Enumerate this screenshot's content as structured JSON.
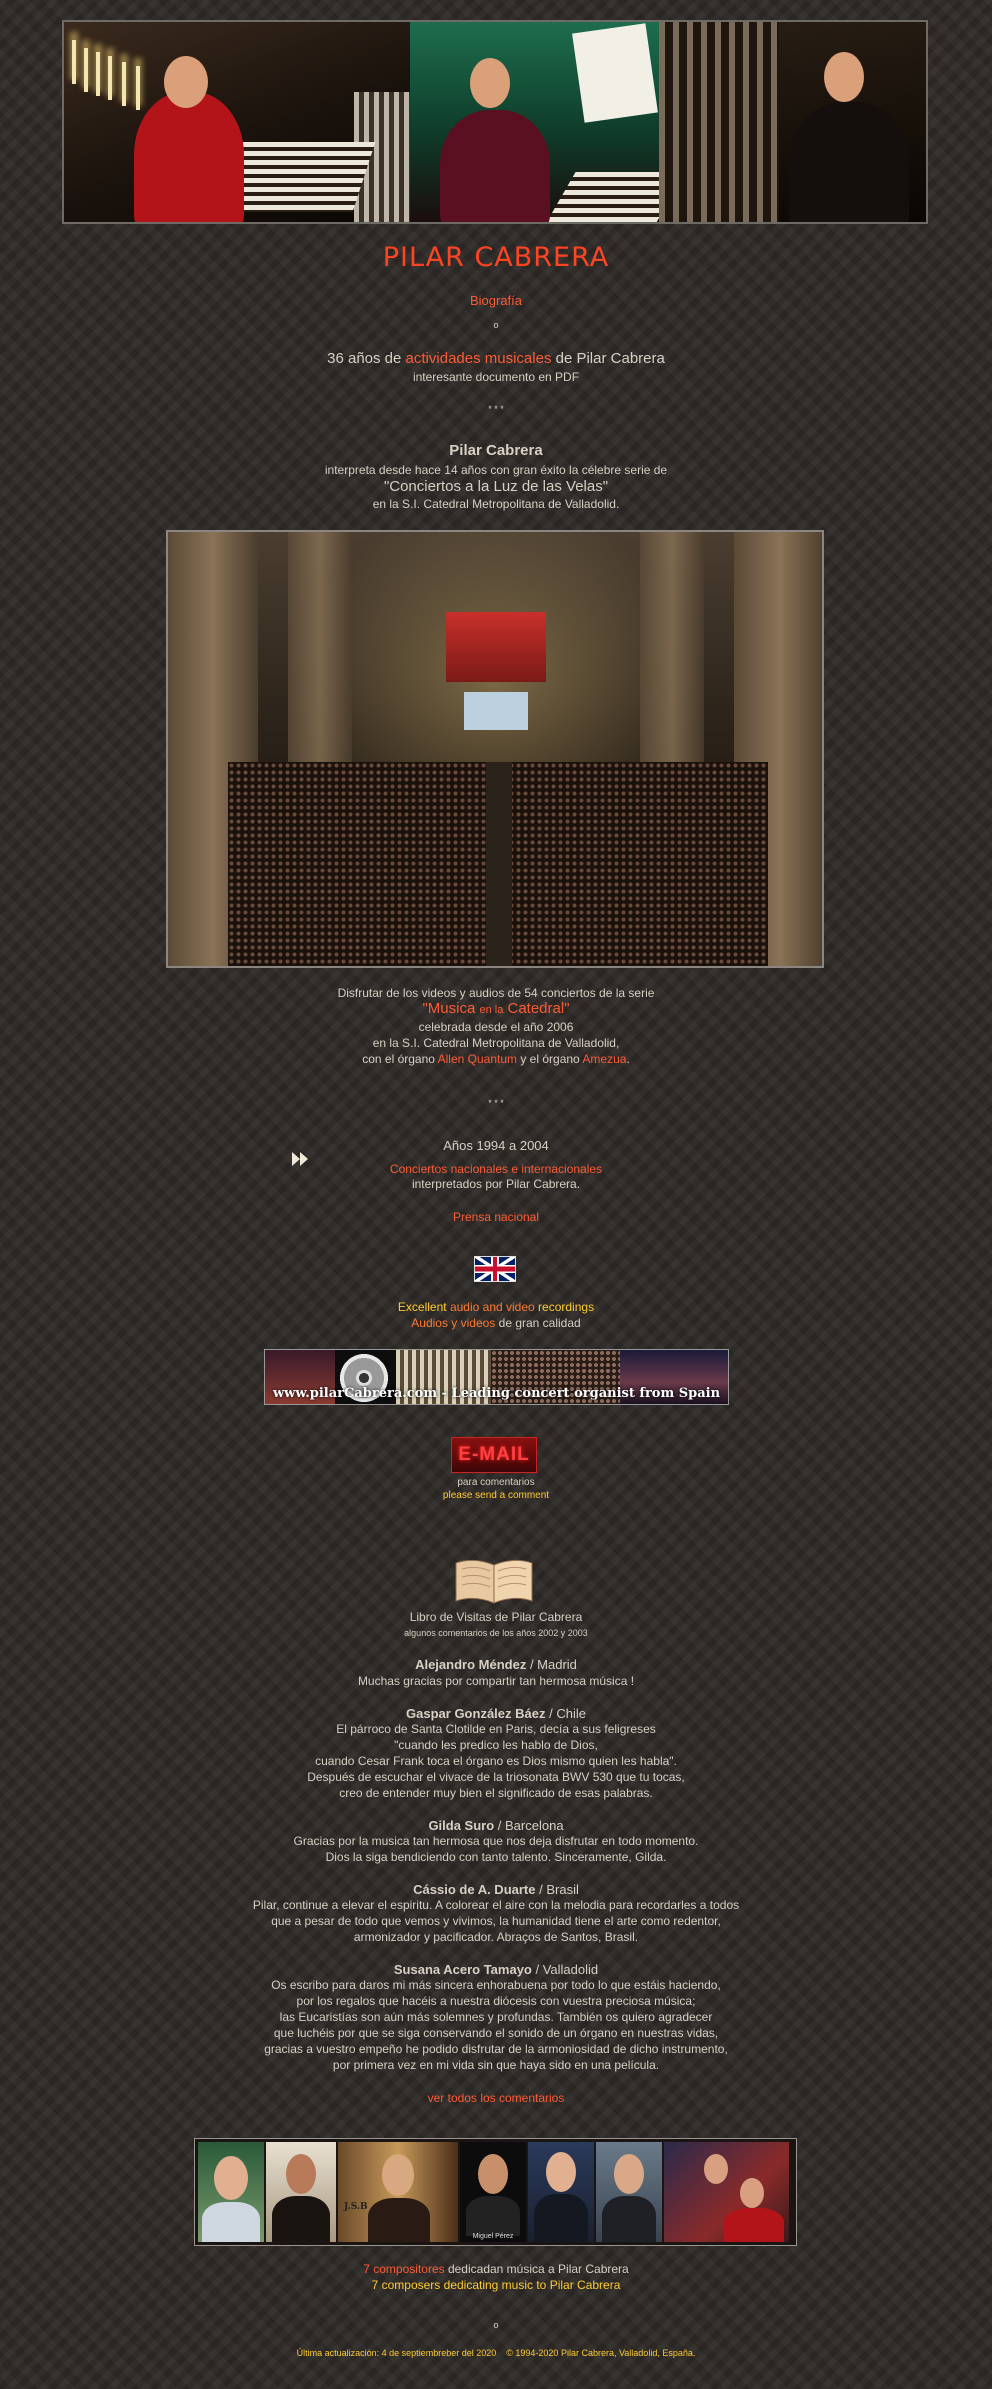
{
  "header": {
    "title": "PILAR CABRERA",
    "biography_link": "Biografía",
    "small_bullet": "o"
  },
  "activities": {
    "prefix": "36 años de ",
    "link": "actividades musicales",
    "suffix": " de Pilar Cabrera",
    "subtitle": "interesante documento en PDF"
  },
  "separator": "* * *",
  "concerts_intro": {
    "name": "Pilar Cabrera",
    "line1": "interpreta desde hace 14 años con gran éxito la célebre serie de",
    "series": "\"Conciertos a la Luz de las Velas\"",
    "line3": "en la S.I. Catedral Metropolitana de Valladolid."
  },
  "videos": {
    "line1": "Disfrutar de los videos y audios de 54 conciertos de la serie",
    "series_prefix": "\"Musica ",
    "series_small": "en la",
    "series_suffix": " Catedral\"",
    "line3": "celebrada desde el año 2006",
    "line4": "en la S.I. Catedral Metropolitana de Valladolid,",
    "organ_prefix": "con el órgano ",
    "organ1": "Allen Quantum",
    "organ_mid": " y el órgano ",
    "organ2": "Amezua",
    "organ_end": "."
  },
  "years": {
    "title": "Años 1994 a 2004",
    "link": "Conciertos nacionales e internacionales",
    "subtitle": "interpretados por Pilar Cabrera.",
    "press": "Prensa nacional"
  },
  "recordings": {
    "en_excellent": "Excellent ",
    "en_link": "audio and video",
    "en_recordings": " recordings",
    "es_link": "Audios y videos",
    "es_suffix": " de gran calidad",
    "banner_text": "www.pilarCabrera.com - Leading concert organist from Spain"
  },
  "email": {
    "button": "E-MAIL",
    "line1": "para comentarios",
    "line2": "please send a comment"
  },
  "guestbook": {
    "title": "Libro de Visitas de Pilar Cabrera",
    "subtitle": "algunos comentarios de los años 2002 y 2003",
    "comments": [
      {
        "name": "Alejandro Méndez",
        "place": " / Madrid",
        "lines": [
          "Muchas gracias por compartir tan hermosa música !"
        ]
      },
      {
        "name": "Gaspar González Báez",
        "place": " / Chile",
        "lines": [
          "El párroco de Santa Clotilde en Paris, decía a sus feligreses",
          "\"cuando les predico les hablo de Dios,",
          "cuando Cesar Frank toca el órgano es Dios mismo quien les habla\".",
          "Después de escuchar el vivace de la triosonata BWV 530 que tu tocas,",
          "creo de entender muy bien el significado de esas palabras."
        ]
      },
      {
        "name": "Gilda Suro",
        "place": " / Barcelona",
        "lines": [
          "Gracias por la musica tan hermosa que nos deja disfrutar en todo momento.",
          "Dios la siga bendiciendo con tanto talento. Sinceramente, Gilda."
        ]
      },
      {
        "name": "Cássio de A. Duarte",
        "place": " / Brasil",
        "lines": [
          "Pilar, continue a elevar el espiritu. A colorear el aire con la melodia para recordarles a todos",
          "que a pesar de todo que vemos y vivimos, la humanidad tiene el arte como redentor,",
          "armonizador y pacificador. Abraços de Santos, Brasil."
        ]
      },
      {
        "name": "Susana Acero Tamayo",
        "place": " / Valladolid",
        "lines": [
          "Os escribo para daros mi más sincera enhorabuena por todo lo que estáis haciendo,",
          "por los regalos que hacéis a nuestra diócesis con vuestra preciosa música;",
          "las Eucaristías son aún más solemnes y profundas. También os quiero agradecer",
          "que luchéis por que se siga conservando el sonido de un órgano en nuestras vidas,",
          "gracias a vuestro empeño he podido disfrutar de la armoniosidad de dicho instrumento,",
          "por primera vez en mi vida sin que haya sido en una película."
        ]
      }
    ],
    "see_all": "ver todos los comentarios"
  },
  "composers": {
    "gallery_caption": "Miguel Pérez",
    "gallery_caption2": "J.S.B",
    "es_link": "7 compositores",
    "es_suffix": " dedicadan música a Pilar Cabrera",
    "en_text": "7 composers dedicating music to Pilar Cabrera"
  },
  "footer": {
    "star": "o",
    "updated": "Última actualización: 4 de septiembreber del 2020",
    "copyright": "© 1994-2020  Pilar Cabrera, Valladolid, España."
  },
  "colors": {
    "background": "#2e2a27",
    "title_red": "#ff4422",
    "link_red": "#ff5a36",
    "link_yellow": "#ffcc33",
    "text": "#d8d0c4"
  }
}
